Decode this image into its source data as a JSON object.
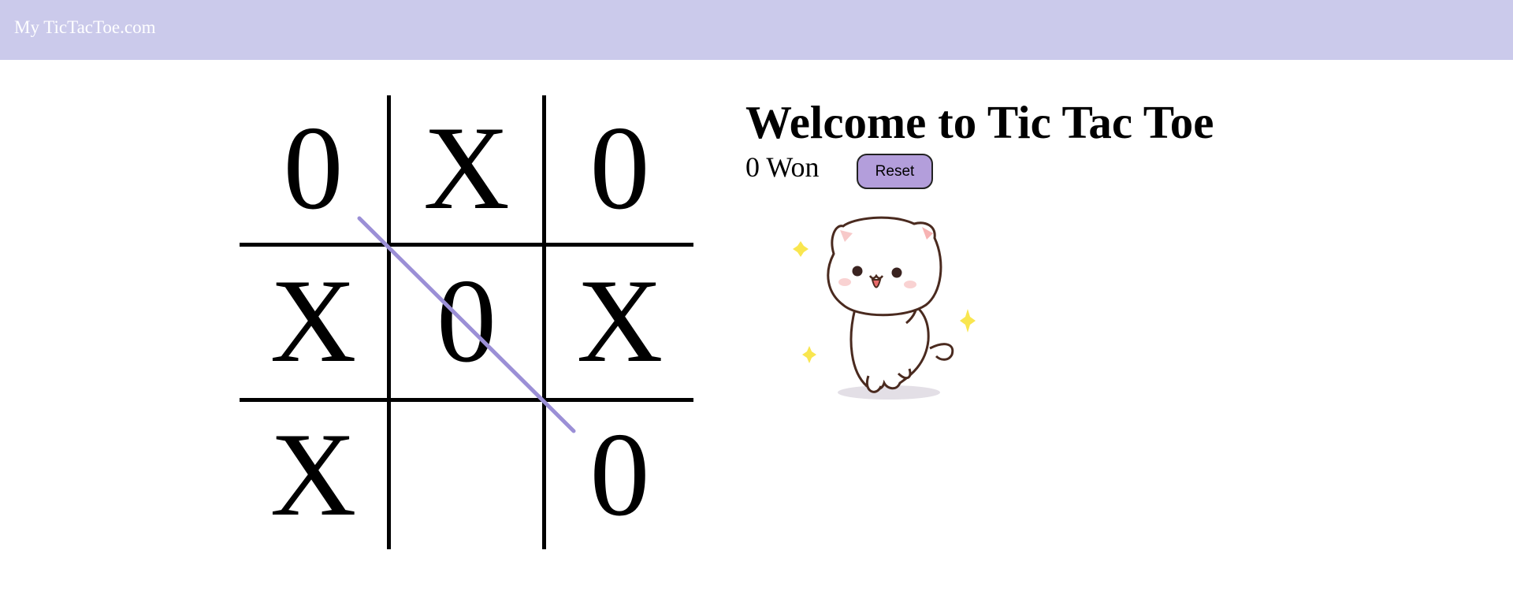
{
  "navbar": {
    "brand": "My TicTacToe.com"
  },
  "board": {
    "cells": [
      "0",
      "X",
      "0",
      "X",
      "0",
      "X",
      "X",
      "",
      "0"
    ],
    "win_line_color": "#9b8fd6"
  },
  "info": {
    "title": "Welcome to Tic Tac Toe",
    "status": "0 Won",
    "reset_label": "Reset"
  },
  "colors": {
    "navbar": "#cbcaeb",
    "button": "#b39edb",
    "sparkle": "#f9e64f"
  },
  "icons": {
    "mascot": "dancing-cat-icon"
  }
}
